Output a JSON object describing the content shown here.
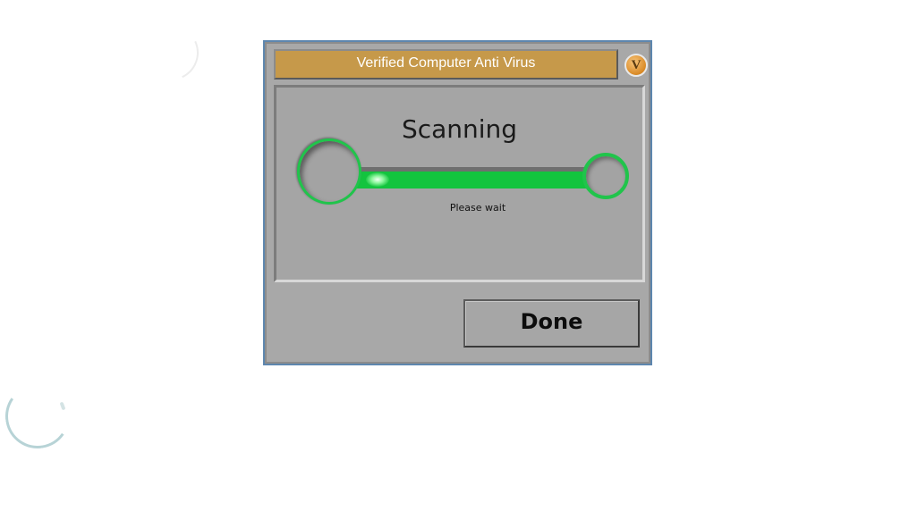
{
  "dialog": {
    "title": "Verified Computer Anti Virus",
    "brand_icon": "v-logo-badge",
    "brand_letter": "V",
    "accent_color": "#c6994a",
    "frame_color": "#a8a8a8"
  },
  "scan": {
    "heading": "Scanning",
    "status_text": "Please wait",
    "progress_color": "#13c43e"
  },
  "actions": {
    "done_label": "Done"
  }
}
